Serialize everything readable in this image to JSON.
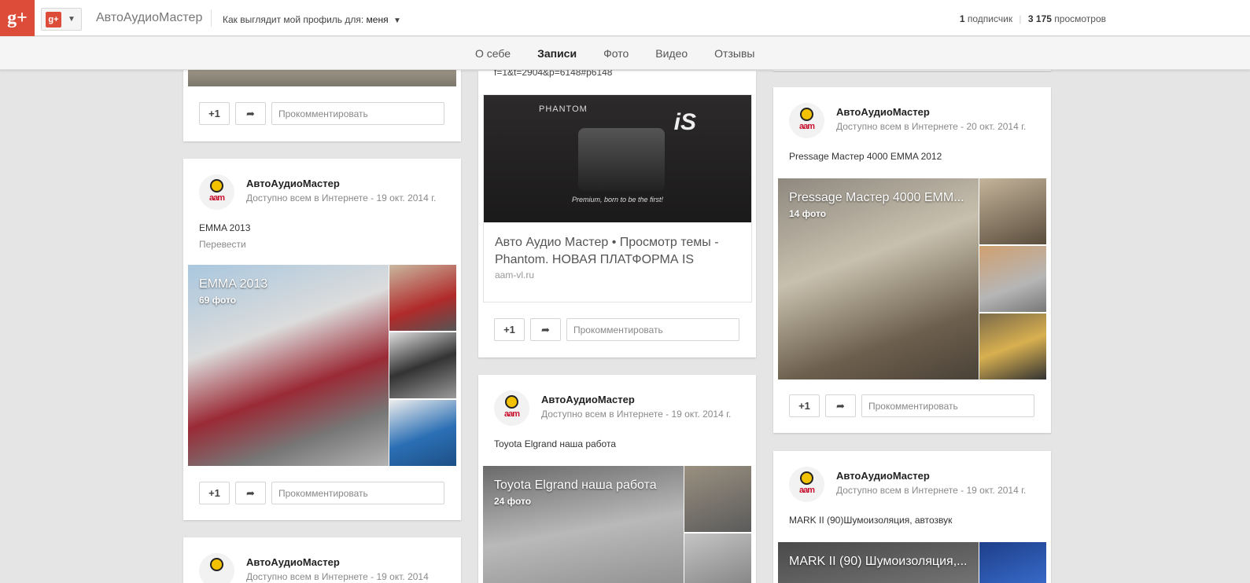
{
  "topbar": {
    "logo": "g+",
    "switcher_icon": "g+",
    "page_title": "АвтоАудиоМастер",
    "view_as_label": "Как выглядит мой профиль для:",
    "view_as_value": "меня",
    "followers_count": "1",
    "followers_label": "подписчик",
    "views_count": "3 175",
    "views_label": "просмотров"
  },
  "tabs": [
    "О себе",
    "Записи",
    "Фото",
    "Видео",
    "Отзывы"
  ],
  "active_tab": "Записи",
  "actions": {
    "plus_one": "+1",
    "comment_placeholder": "Прокомментировать"
  },
  "posts": [
    {
      "author": "АвтоАудиоМастер",
      "visibility": "Доступно всем в Интернете",
      "date": "19 окт. 2014 г.",
      "text": "EMMA 2013",
      "translate": "Перевести",
      "album_title": "EMMA 2013",
      "album_count": "69 фото"
    },
    {
      "url_fragment": "f=1&t=2904&p=6148#p6148",
      "link_title": "Авто Аудио Мастер • Просмотр темы - Phantom. НОВАЯ ПЛАТФОРМА IS",
      "link_domain": "aam-vl.ru",
      "banner_brand": "PHANTOM",
      "banner_model": "iS",
      "banner_tagline": "Premium, born to be the first!"
    },
    {
      "author": "АвтоАудиоМастер",
      "visibility": "Доступно всем в Интернете",
      "date": "19 окт. 2014 г.",
      "text": "Toyota Elgrand наша работа",
      "album_title": "Toyota Elgrand наша работа",
      "album_count": "24 фото"
    },
    {
      "author": "АвтоАудиоМастер",
      "visibility": "Доступно всем в Интернете",
      "date": "20 окт. 2014 г.",
      "text": "Pressage Мастер 4000 EMMA 2012",
      "album_title": "Pressage Мастер 4000 EMM...",
      "album_count": "14 фото"
    },
    {
      "author": "АвтоАудиоМастер",
      "visibility": "Доступно всем в Интернете",
      "date": "19 окт. 2014 г.",
      "text": "MARK II (90)Шумоизоляция, автозвук",
      "album_title": "MARK II (90) Шумоизоляция,..."
    },
    {
      "author": "АвтоАудиоМастер",
      "visibility": "Доступно всем в Интернете",
      "date": "19 окт. 2014"
    }
  ],
  "avatar_logo_text": "aam",
  "meta_separator": "-"
}
